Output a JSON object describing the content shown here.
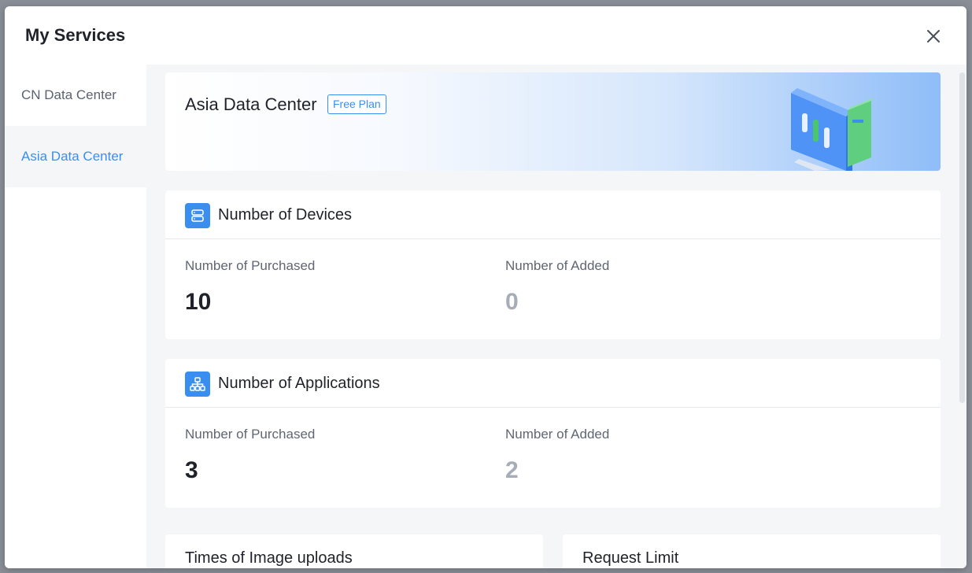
{
  "modal": {
    "title": "My Services"
  },
  "sidebar": {
    "items": [
      {
        "label": "CN Data Center",
        "active": false
      },
      {
        "label": "Asia Data Center",
        "active": true
      }
    ]
  },
  "banner": {
    "title": "Asia Data Center",
    "badge": "Free Plan"
  },
  "devices": {
    "title": "Number of Devices",
    "purchased_label": "Number of Purchased",
    "purchased_value": "10",
    "added_label": "Number of Added",
    "added_value": "0"
  },
  "applications": {
    "title": "Number of Applications",
    "purchased_label": "Number of Purchased",
    "purchased_value": "3",
    "added_label": "Number of Added",
    "added_value": "2"
  },
  "image_uploads": {
    "title": "Times of Image uploads"
  },
  "request_limit": {
    "title": "Request Limit"
  },
  "colors": {
    "accent": "#3a8ef0",
    "text": "#1f2329",
    "muted": "#a7adb8",
    "background": "#f5f6f8"
  },
  "icons": {
    "close": "close-icon",
    "devices": "server-icon",
    "applications": "hierarchy-icon"
  }
}
